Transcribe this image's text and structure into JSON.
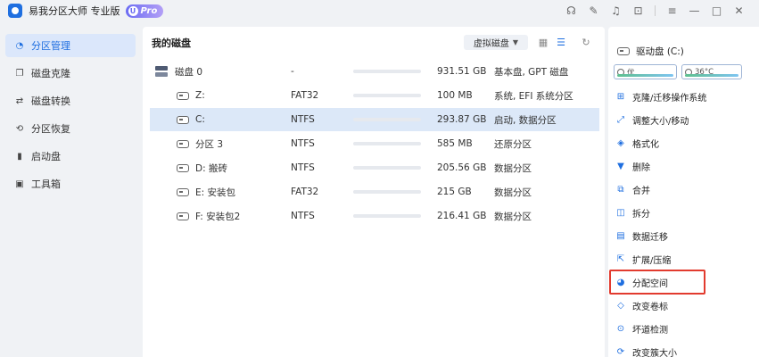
{
  "titlebar": {
    "title": "易我分区大师 专业版",
    "badge": "Pro",
    "badge_letter": "U",
    "actions": [
      "headset-icon",
      "feedback-icon",
      "bell-icon",
      "export-icon",
      "menu-icon",
      "minimize-icon",
      "maximize-icon",
      "close-icon"
    ]
  },
  "nav": {
    "items": [
      {
        "label": "分区管理",
        "icon": "pie-icon",
        "active": true
      },
      {
        "label": "磁盘克隆",
        "icon": "copy-icon",
        "active": false
      },
      {
        "label": "磁盘转换",
        "icon": "convert-icon",
        "active": false
      },
      {
        "label": "分区恢复",
        "icon": "recover-icon",
        "active": false
      },
      {
        "label": "启动盘",
        "icon": "usb-icon",
        "active": false
      },
      {
        "label": "工具箱",
        "icon": "toolbox-icon",
        "active": false
      }
    ]
  },
  "main": {
    "title": "我的磁盘",
    "virtual_label": "虚拟磁盘",
    "rows": [
      {
        "name": "磁盘 0",
        "fs": "-",
        "usage": 0.98,
        "size": "931.51 GB",
        "info": "基本盘, GPT 磁盘",
        "kind": "disk"
      },
      {
        "name": "Z:",
        "fs": "FAT32",
        "usage": 0.68,
        "size": "100 MB",
        "info": "系统, EFI 系统分区",
        "kind": "part"
      },
      {
        "name": "C:",
        "fs": "NTFS",
        "usage": 0.46,
        "size": "293.87 GB",
        "info": "启动, 数据分区",
        "kind": "part",
        "selected": true
      },
      {
        "name": "分区 3",
        "fs": "NTFS",
        "usage": 0.83,
        "size": "585 MB",
        "info": "还原分区",
        "kind": "part"
      },
      {
        "name": "D: 搬砖",
        "fs": "NTFS",
        "usage": 0.02,
        "size": "205.56 GB",
        "info": "数据分区",
        "kind": "part"
      },
      {
        "name": "E: 安装包",
        "fs": "FAT32",
        "usage": 0.54,
        "size": "215 GB",
        "info": "数据分区",
        "kind": "part"
      },
      {
        "name": "F: 安装包2",
        "fs": "NTFS",
        "usage": 0.35,
        "size": "216.41 GB",
        "info": "数据分区",
        "kind": "part"
      }
    ]
  },
  "right": {
    "drive_label": "驱动盘 (C:)",
    "health_label": "优",
    "temp_label": "36°C",
    "ops": [
      {
        "label": "克隆/迁移操作系统",
        "icon": "windows-icon"
      },
      {
        "label": "调整大小/移动",
        "icon": "resize-icon"
      },
      {
        "label": "格式化",
        "icon": "format-icon"
      },
      {
        "label": "删除",
        "icon": "trash-icon"
      },
      {
        "label": "合并",
        "icon": "merge-icon"
      },
      {
        "label": "拆分",
        "icon": "split-icon"
      },
      {
        "label": "数据迁移",
        "icon": "migrate-icon"
      },
      {
        "label": "扩展/压缩",
        "icon": "extend-icon"
      },
      {
        "label": "分配空间",
        "icon": "allocate-icon"
      },
      {
        "label": "改变卷标",
        "icon": "label-icon"
      },
      {
        "label": "坏道检测",
        "icon": "check-icon"
      },
      {
        "label": "改变簇大小",
        "icon": "cluster-icon"
      }
    ]
  },
  "colors": {
    "accent": "#1f6fe0",
    "highlight": "#e23b2f"
  }
}
